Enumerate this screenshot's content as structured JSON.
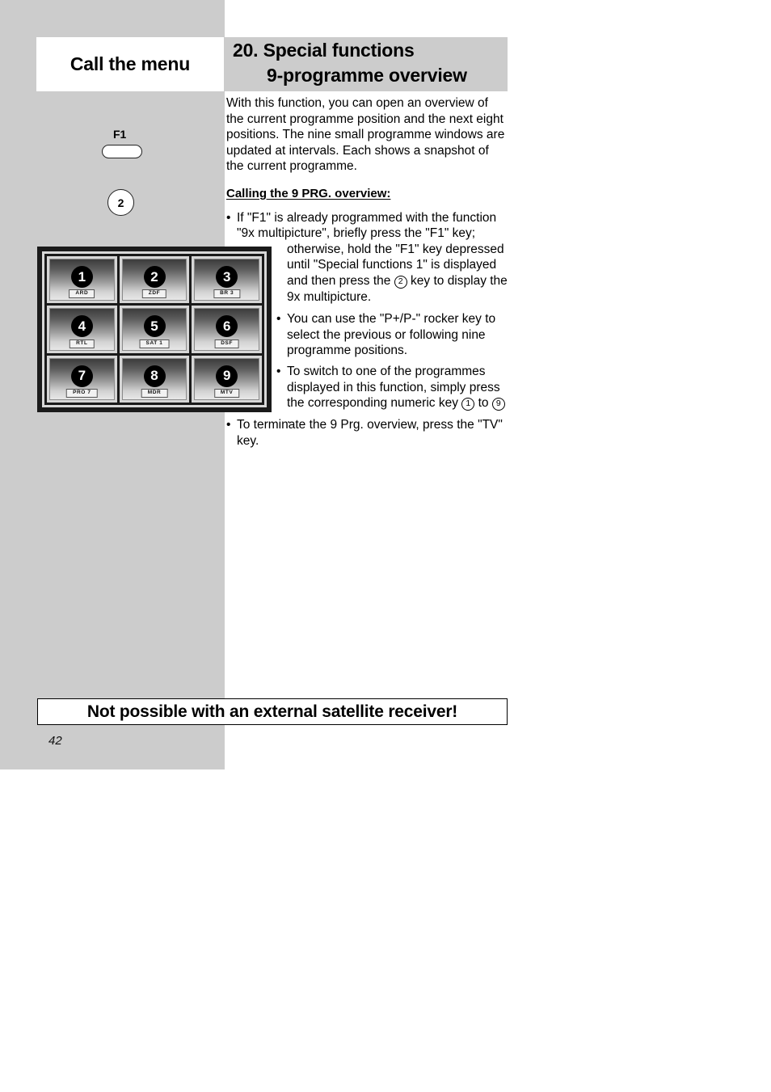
{
  "page": {
    "number": "42",
    "left_heading": "Call the menu",
    "title_line_1": "20. Special functions",
    "title_line_2": "9-programme overview"
  },
  "keys": {
    "f1_label": "F1",
    "f1_key_name": "f1-pill-key",
    "numeric_key_2": "2"
  },
  "body": {
    "intro": "With this function, you can open an overview of the current programme position and the next eight positions. The nine small programme windows are updated at intervals. Each shows a snapshot of the current programme.",
    "section_heading": "Calling the 9 PRG. overview:",
    "bullet_1_part_1": "If \"F1\" is already programmed with the function \"9x multipicture\", briefly press the \"F1\" key;",
    "bullet_1_part_2_a": "otherwise, hold the \"F1\" key depressed until \"Special functions 1\" is displayed and then press the",
    "bullet_1_circle": "2",
    "bullet_1_part_2_b": "key to display the 9x multipicture.",
    "bullet_2": "You can use the \"P+/P-\" rocker key to select the previous or following nine programme positions.",
    "bullet_3_a": "To switch to one of the programmes displayed in this function, simply press the corresponding numeric key",
    "bullet_3_circle_from": "1",
    "bullet_3_mid": "to",
    "bullet_3_circle_to": "9",
    "bullet_3_end": ".",
    "bullet_4": "To terminate the 9 Prg. overview, press the \"TV\" key.",
    "bullet_marker": "•"
  },
  "tv_grid": {
    "rows": [
      [
        {
          "number": "1",
          "label": "ARD"
        },
        {
          "number": "2",
          "label": "ZDF"
        },
        {
          "number": "3",
          "label": "BR 3"
        }
      ],
      [
        {
          "number": "4",
          "label": "RTL"
        },
        {
          "number": "5",
          "label": "SAT 1"
        },
        {
          "number": "6",
          "label": "DSF"
        }
      ],
      [
        {
          "number": "7",
          "label": "PRO 7"
        },
        {
          "number": "8",
          "label": "MDR"
        },
        {
          "number": "9",
          "label": "MTV"
        }
      ]
    ]
  },
  "warning": {
    "text": "Not possible with an external satellite receiver!"
  },
  "colors": {
    "margin_grey": "#cccccc",
    "page_white": "#ffffff",
    "ink_black": "#000000"
  }
}
